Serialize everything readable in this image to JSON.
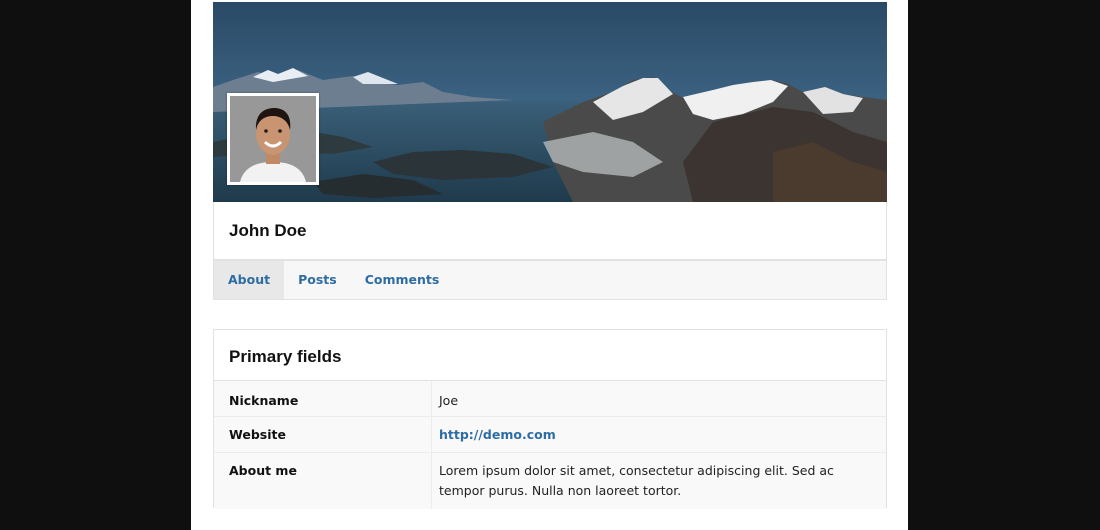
{
  "profile": {
    "name": "John Doe",
    "cover_alt": "mountain-landscape-cover",
    "avatar_alt": "user-avatar"
  },
  "tabs": [
    {
      "label": "About",
      "active": true
    },
    {
      "label": "Posts",
      "active": false
    },
    {
      "label": "Comments",
      "active": false
    }
  ],
  "primary_fields": {
    "title": "Primary fields",
    "rows": [
      {
        "label": "Nickname",
        "value": "Joe"
      },
      {
        "label": "Website",
        "value": "http://demo.com"
      },
      {
        "label": "About me",
        "value": "Lorem ipsum dolor sit amet, consectetur adipiscing elit. Sed ac tempor purus. Nulla non laoreet tortor."
      }
    ]
  },
  "colors": {
    "link": "#2e6da4",
    "background_outer": "#0f0f0f",
    "tab_active_bg": "#e8e8e8"
  }
}
